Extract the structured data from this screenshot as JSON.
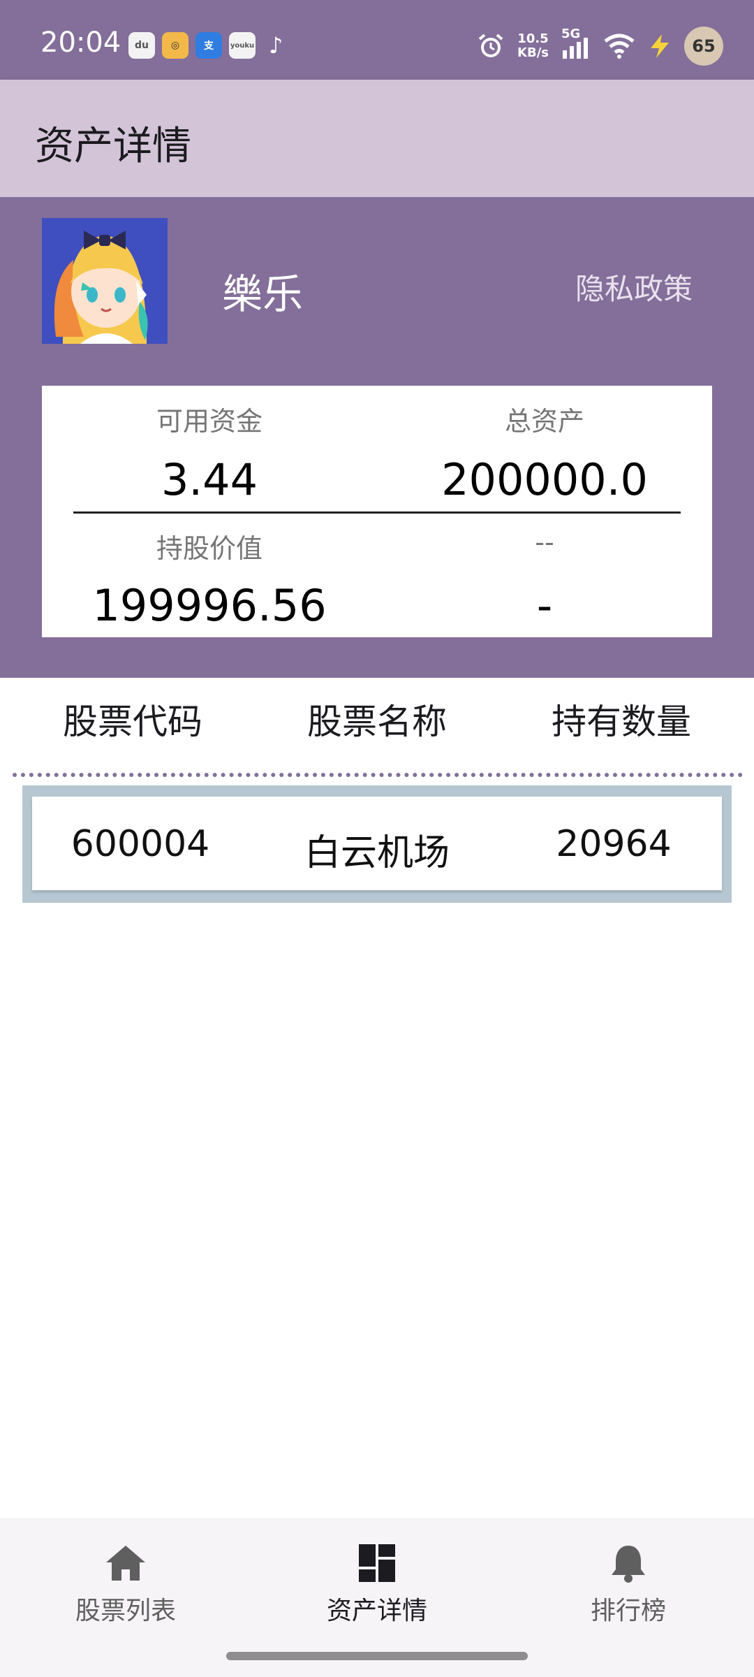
{
  "status_bar": {
    "time": "20:04",
    "app_icons": [
      "du",
      "◎",
      "支",
      "youku",
      "♪"
    ],
    "net_speed_value": "10.5",
    "net_speed_unit": "KB/s",
    "network": "5G",
    "battery": "65"
  },
  "app_bar": {
    "title": "资产详情"
  },
  "profile": {
    "username": "樂乐",
    "privacy_link": "隐私政策"
  },
  "assets": {
    "available_funds_label": "可用资金",
    "available_funds_value": "3.44",
    "total_assets_label": "总资产",
    "total_assets_value": "200000.0",
    "holding_value_label": "持股价值",
    "holding_value_value": "199996.56",
    "extra_label": "--",
    "extra_value": "-"
  },
  "table": {
    "headers": [
      "股票代码",
      "股票名称",
      "持有数量"
    ],
    "rows": [
      {
        "code": "600004",
        "name": "白云机场",
        "quantity": "20964"
      }
    ]
  },
  "bottom_nav": {
    "items": [
      {
        "label": "股票列表",
        "icon": "home-icon"
      },
      {
        "label": "资产详情",
        "icon": "dashboard-icon"
      },
      {
        "label": "排行榜",
        "icon": "bell-icon"
      }
    ],
    "active_index": 1
  },
  "colors": {
    "primary": "#836f99",
    "app_bar": "#d3c4d8",
    "row_border": "#b6c7d2"
  }
}
